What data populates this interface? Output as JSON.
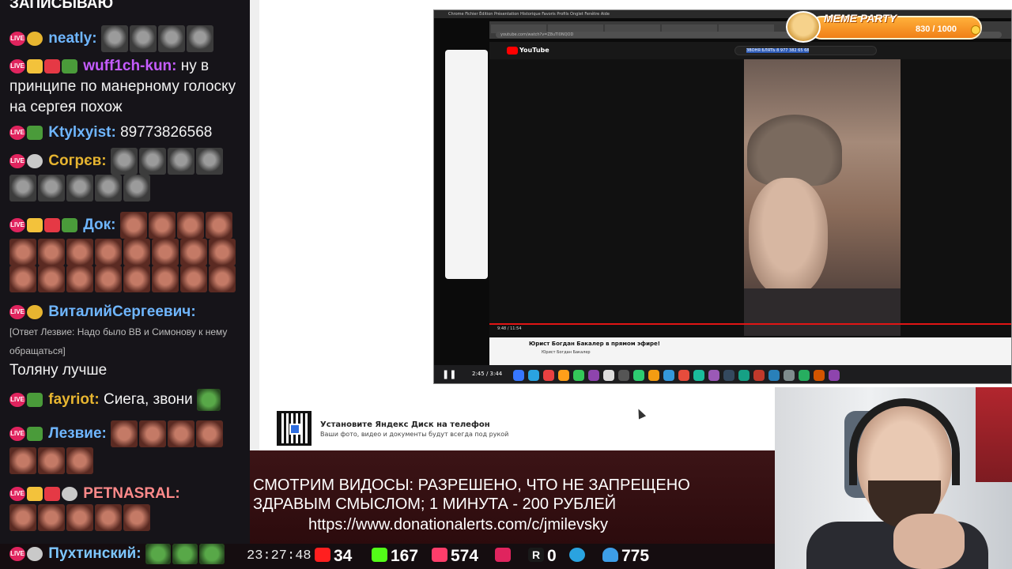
{
  "chat": {
    "top_line": "ЗАПИСЫВАЮ",
    "messages": [
      {
        "nick": "neatly:",
        "nick_color": "#6fb6ff",
        "text": ""
      },
      {
        "nick": "wuff1ch-kun:",
        "nick_color": "#c55cff",
        "text": "ну в принципе по манерному голоску на сергея похож"
      },
      {
        "nick": "Ktylxyist:",
        "nick_color": "#6fb6ff",
        "text": "89773826568"
      },
      {
        "nick": "Согрєв:",
        "nick_color": "#e7b530",
        "text": ""
      },
      {
        "nick": "Док:",
        "nick_color": "#6fb6ff",
        "text": ""
      },
      {
        "nick": "ВиталийСергеевич:",
        "nick_color": "#6fb6ff",
        "reply": "[Ответ Лезвие: Надо было ВВ и Симонову к нему обращаться]",
        "text": "Толяну лучше"
      },
      {
        "nick": "fayriot:",
        "nick_color": "#e7b530",
        "text": "Сиега, звони"
      },
      {
        "nick": "Лезвие:",
        "nick_color": "#6fb6ff",
        "text": ""
      },
      {
        "nick": "PETNASRAL:",
        "nick_color": "#ff8a8a",
        "text": ""
      }
    ],
    "last_nick": "Пухтинский:"
  },
  "video": {
    "menubar": "Chrome  Fichier  Édition  Présentation  Historique  Favoris  Profils  Onglet  Fenêtre  Aide",
    "address": "youtube.com/watch?v=Z8uTI0NQOD",
    "search_highlight": "ЗВОНЯ БЛЯТЬ 8 977 382 65 68",
    "yt_logo": "YouTube",
    "player_time": "9:48 / 11:54",
    "video_title": "Юрист Богдан Бакалер в прямом эфире!",
    "channel": "Юрист Богдан Бакалер",
    "dock_time": "2:45 / 3:44"
  },
  "meme_party": {
    "title": "MEME PARTY",
    "count": "830 / 1000"
  },
  "ydisk": {
    "title": "Установите Яндекс Диск на телефон",
    "subtitle": "Ваши фото, видео и документы будут всегда под рукой"
  },
  "rules": {
    "line1": "СМОТРИМ ВИДОСЫ: РАЗРЕШЕНО, ЧТО НЕ ЗАПРЕЩЕНО",
    "line2": "ЗДРАВЫМ СМЫСЛОМ; 1 МИНУТА - 200 РУБЛЕЙ",
    "line3": "https://www.donationalerts.com/c/jmilevsky"
  },
  "stats": {
    "clock": "23:27:48",
    "youtube": "34",
    "kick": "167",
    "vk": "574",
    "rutube": "",
    "r": "0",
    "telegram": "",
    "users": "775",
    "colors": {
      "youtube": "#ff1f1f",
      "kick": "#53fc18",
      "vk": "#ff3d6a",
      "rutube": "#e0245e",
      "telegram": "#2aa3e0",
      "users": "#3d9ee8"
    }
  }
}
